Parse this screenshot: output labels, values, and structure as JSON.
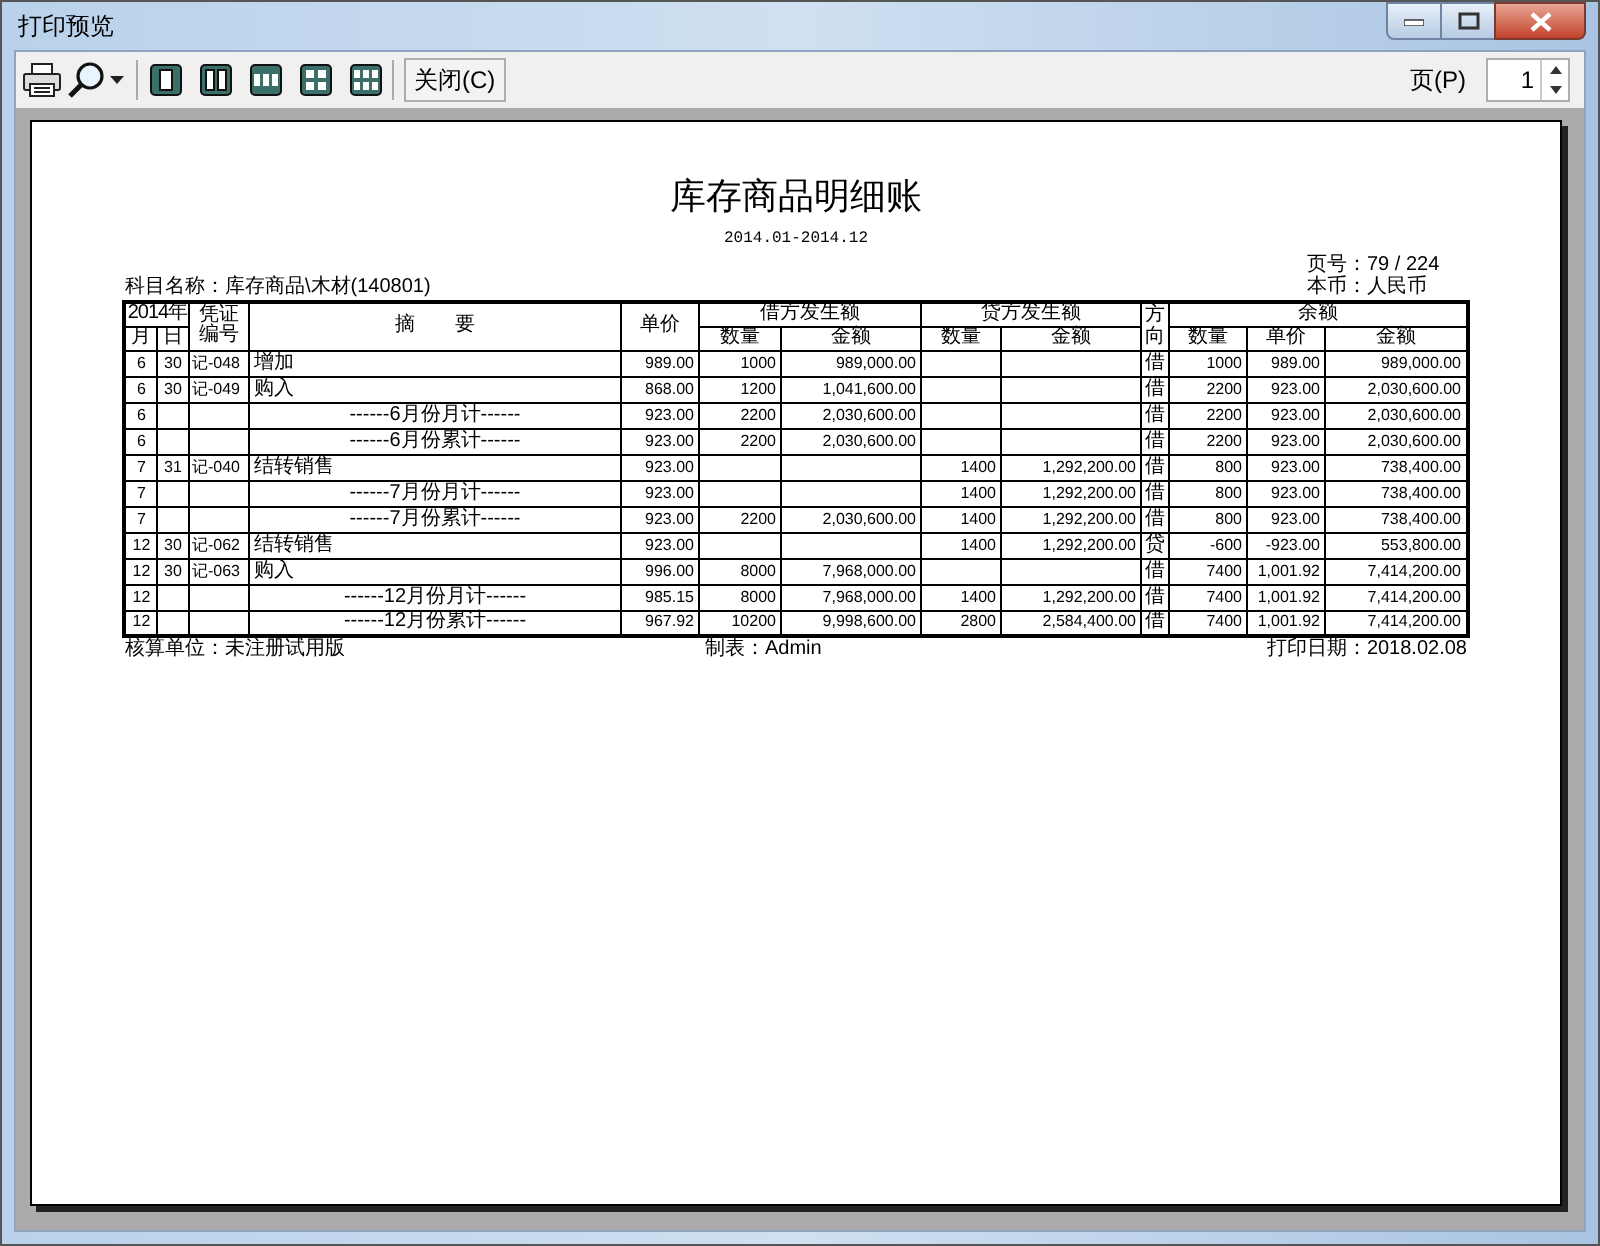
{
  "window": {
    "title": "打印预览"
  },
  "toolbar": {
    "close_button": "关闭(C)",
    "page_label": "页(P)",
    "page_value": "1"
  },
  "report": {
    "title": "库存商品明细账",
    "period": "2014.01-2014.12",
    "page_no": "页号：79 / 224",
    "subject": "科目名称：库存商品\\木材(140801)",
    "currency": "本币：人民币",
    "header": {
      "year": "2014年",
      "month": "月",
      "day": "日",
      "voucher": "凭证编号",
      "summary": "摘　　要",
      "price": "单价",
      "debit": "借方发生额",
      "credit": "贷方发生额",
      "direction": "方向",
      "balance": "余额",
      "debit_qty": "数量",
      "debit_amount": "金额",
      "credit_qty": "数量",
      "credit_amount": "金额",
      "balance_qty": "数量",
      "balance_price": "单价",
      "balance_amount": "金额"
    },
    "rows": [
      {
        "kind": "entry",
        "month": "6",
        "day": "30",
        "voucher": "记-048",
        "summary": "增加",
        "price": "989.00",
        "debit_qty": "1000",
        "debit_amount": "989,000.00",
        "direction": "借",
        "balance_qty": "1000",
        "balance_price": "989.00",
        "balance_amount": "989,000.00"
      },
      {
        "kind": "entry",
        "month": "6",
        "day": "30",
        "voucher": "记-049",
        "summary": "购入",
        "price": "868.00",
        "debit_qty": "1200",
        "debit_amount": "1,041,600.00",
        "direction": "借",
        "balance_qty": "2200",
        "balance_price": "923.00",
        "balance_amount": "2,030,600.00"
      },
      {
        "kind": "subtotal",
        "month": "6",
        "summary": "------6月份月计------",
        "price": "923.00",
        "debit_qty": "2200",
        "debit_amount": "2,030,600.00",
        "direction": "借",
        "balance_qty": "2200",
        "balance_price": "923.00",
        "balance_amount": "2,030,600.00"
      },
      {
        "kind": "subtotal",
        "month": "6",
        "summary": "------6月份累计------",
        "price": "923.00",
        "debit_qty": "2200",
        "debit_amount": "2,030,600.00",
        "direction": "借",
        "balance_qty": "2200",
        "balance_price": "923.00",
        "balance_amount": "2,030,600.00"
      },
      {
        "kind": "entry",
        "month": "7",
        "day": "31",
        "voucher": "记-040",
        "summary": "结转销售",
        "price": "923.00",
        "credit_qty": "1400",
        "credit_amount": "1,292,200.00",
        "direction": "借",
        "balance_qty": "800",
        "balance_price": "923.00",
        "balance_amount": "738,400.00"
      },
      {
        "kind": "subtotal",
        "month": "7",
        "summary": "------7月份月计------",
        "price": "923.00",
        "credit_qty": "1400",
        "credit_amount": "1,292,200.00",
        "direction": "借",
        "balance_qty": "800",
        "balance_price": "923.00",
        "balance_amount": "738,400.00"
      },
      {
        "kind": "subtotal",
        "month": "7",
        "summary": "------7月份累计------",
        "price": "923.00",
        "debit_qty": "2200",
        "debit_amount": "2,030,600.00",
        "credit_qty": "1400",
        "credit_amount": "1,292,200.00",
        "direction": "借",
        "balance_qty": "800",
        "balance_price": "923.00",
        "balance_amount": "738,400.00"
      },
      {
        "kind": "entry",
        "month": "12",
        "day": "30",
        "voucher": "记-062",
        "summary": "结转销售",
        "price": "923.00",
        "credit_qty": "1400",
        "credit_amount": "1,292,200.00",
        "direction": "贷",
        "balance_qty": "-600",
        "balance_price": "-923.00",
        "balance_amount": "553,800.00"
      },
      {
        "kind": "entry",
        "month": "12",
        "day": "30",
        "voucher": "记-063",
        "summary": "购入",
        "price": "996.00",
        "debit_qty": "8000",
        "debit_amount": "7,968,000.00",
        "direction": "借",
        "balance_qty": "7400",
        "balance_price": "1,001.92",
        "balance_amount": "7,414,200.00"
      },
      {
        "kind": "subtotal",
        "month": "12",
        "summary": "------12月份月计------",
        "price": "985.15",
        "debit_qty": "8000",
        "debit_amount": "7,968,000.00",
        "credit_qty": "1400",
        "credit_amount": "1,292,200.00",
        "direction": "借",
        "balance_qty": "7400",
        "balance_price": "1,001.92",
        "balance_amount": "7,414,200.00"
      },
      {
        "kind": "subtotal",
        "month": "12",
        "summary": "------12月份累计------",
        "price": "967.92",
        "debit_qty": "10200",
        "debit_amount": "9,998,600.00",
        "credit_qty": "2800",
        "credit_amount": "2,584,400.00",
        "direction": "借",
        "balance_qty": "7400",
        "balance_price": "1,001.92",
        "balance_amount": "7,414,200.00"
      }
    ],
    "footer": {
      "unit": "核算单位：未注册试用版",
      "maker": "制表：Admin",
      "print_date": "打印日期：2018.02.08"
    }
  }
}
